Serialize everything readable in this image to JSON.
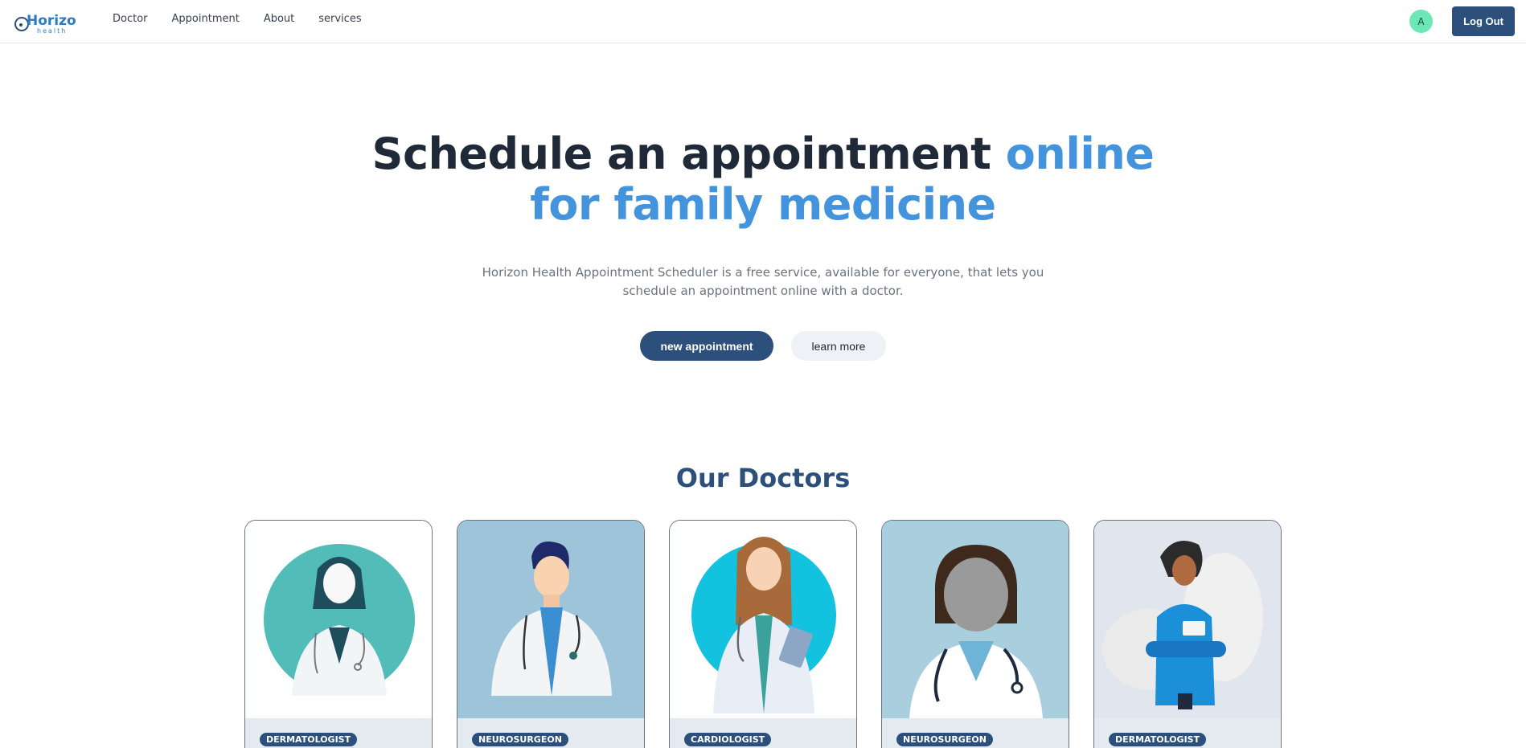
{
  "nav": {
    "logo_text_top": "Horizon",
    "logo_text_bottom": "health",
    "links": [
      "Doctor",
      "Appointment",
      "About",
      "services"
    ],
    "avatar_initial": "A",
    "logout_label": "Log Out"
  },
  "hero": {
    "title_part1": "Schedule an appointment ",
    "title_accent": "online for family medicine",
    "subtitle": "Horizon Health Appointment Scheduler is a free service, available for everyone, that lets you schedule an appointment online with a doctor.",
    "primary_button": "new appointment",
    "secondary_button": "learn more"
  },
  "doctors": {
    "title": "Our Doctors",
    "cards": [
      {
        "specialty": "DERMATOLOGIST"
      },
      {
        "specialty": "NEUROSURGEON"
      },
      {
        "specialty": "CARDIOLOGIST"
      },
      {
        "specialty": "NEUROSURGEON"
      },
      {
        "specialty": "DERMATOLOGIST"
      }
    ]
  },
  "colors": {
    "brand": "#2c4f7c",
    "accent": "#4394dd",
    "avatar": "#6ee7b7"
  }
}
